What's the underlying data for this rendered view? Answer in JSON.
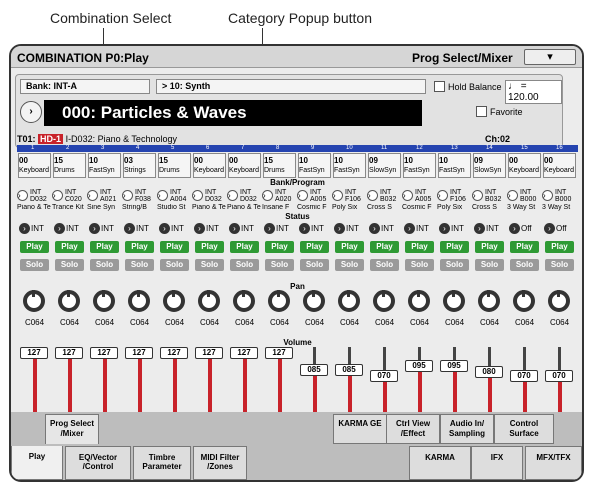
{
  "callouts": {
    "combo_select": "Combination Select",
    "category_popup": "Category Popup button"
  },
  "header": {
    "title": "COMBINATION P0:Play",
    "page_menu": "Prog Select/Mixer",
    "menu_arrow": "▾"
  },
  "bank": {
    "label": "Bank: INT-A",
    "category": "10: Synth",
    "hold_balance": "Hold Balance",
    "tempo": "♩ = 120.00"
  },
  "combination": {
    "name": "000: Particles & Waves",
    "favorite": "Favorite"
  },
  "timbre_info": {
    "timbre": "T01:",
    "hd": "HD-1",
    "program": "I-D032: Piano & Technology",
    "channel": "Ch:02"
  },
  "section_labels": {
    "bank_program": "Bank/Program",
    "status": "Status",
    "pan": "Pan",
    "volume": "Volume"
  },
  "timbres": [
    {
      "num": "1",
      "cat_num": "00",
      "cat": "Keyboard",
      "bank": "INT",
      "prog": "D032",
      "name": "Piano & Te",
      "status": "INT",
      "play": "Play",
      "solo": "Solo",
      "pan": "C064",
      "vol": "127",
      "level": 1.0
    },
    {
      "num": "2",
      "cat_num": "15",
      "cat": "Drums",
      "bank": "INT",
      "prog": "C020",
      "name": "Trance Kit",
      "status": "INT",
      "play": "Play",
      "solo": "Solo",
      "pan": "C064",
      "vol": "127",
      "level": 1.0
    },
    {
      "num": "3",
      "cat_num": "10",
      "cat": "FastSyn",
      "bank": "INT",
      "prog": "A021",
      "name": "Sine Syn",
      "status": "INT",
      "play": "Play",
      "solo": "Solo",
      "pan": "C064",
      "vol": "127",
      "level": 1.0
    },
    {
      "num": "4",
      "cat_num": "03",
      "cat": "Strings",
      "bank": "INT",
      "prog": "F038",
      "name": "String/B",
      "status": "INT",
      "play": "Play",
      "solo": "Solo",
      "pan": "C064",
      "vol": "127",
      "level": 1.0
    },
    {
      "num": "5",
      "cat_num": "15",
      "cat": "Drums",
      "bank": "INT",
      "prog": "A004",
      "name": "Studio St",
      "status": "INT",
      "play": "Play",
      "solo": "Solo",
      "pan": "C064",
      "vol": "127",
      "level": 1.0
    },
    {
      "num": "6",
      "cat_num": "00",
      "cat": "Keyboard",
      "bank": "INT",
      "prog": "D032",
      "name": "Piano & Te",
      "status": "INT",
      "play": "Play",
      "solo": "Solo",
      "pan": "C064",
      "vol": "127",
      "level": 1.0
    },
    {
      "num": "7",
      "cat_num": "00",
      "cat": "Keyboard",
      "bank": "INT",
      "prog": "D032",
      "name": "Piano & Te",
      "status": "INT",
      "play": "Play",
      "solo": "Solo",
      "pan": "C064",
      "vol": "127",
      "level": 1.0
    },
    {
      "num": "8",
      "cat_num": "15",
      "cat": "Drums",
      "bank": "INT",
      "prog": "A020",
      "name": "Insane F",
      "status": "INT",
      "play": "Play",
      "solo": "Solo",
      "pan": "C064",
      "vol": "127",
      "level": 1.0
    },
    {
      "num": "9",
      "cat_num": "10",
      "cat": "FastSyn",
      "bank": "INT",
      "prog": "A005",
      "name": "Cosmic F",
      "status": "INT",
      "play": "Play",
      "solo": "Solo",
      "pan": "C064",
      "vol": "085",
      "level": 0.67
    },
    {
      "num": "10",
      "cat_num": "10",
      "cat": "FastSyn",
      "bank": "INT",
      "prog": "F106",
      "name": "Poly Six",
      "status": "INT",
      "play": "Play",
      "solo": "Solo",
      "pan": "C064",
      "vol": "085",
      "level": 0.67
    },
    {
      "num": "11",
      "cat_num": "09",
      "cat": "SlowSyn",
      "bank": "INT",
      "prog": "B032",
      "name": "Cross S",
      "status": "INT",
      "play": "Play",
      "solo": "Solo",
      "pan": "C064",
      "vol": "070",
      "level": 0.55
    },
    {
      "num": "12",
      "cat_num": "10",
      "cat": "FastSyn",
      "bank": "INT",
      "prog": "A005",
      "name": "Cosmic F",
      "status": "INT",
      "play": "Play",
      "solo": "Solo",
      "pan": "C064",
      "vol": "095",
      "level": 0.75
    },
    {
      "num": "13",
      "cat_num": "10",
      "cat": "FastSyn",
      "bank": "INT",
      "prog": "F106",
      "name": "Poly Six",
      "status": "INT",
      "play": "Play",
      "solo": "Solo",
      "pan": "C064",
      "vol": "095",
      "level": 0.75
    },
    {
      "num": "14",
      "cat_num": "09",
      "cat": "SlowSyn",
      "bank": "INT",
      "prog": "B032",
      "name": "Cross S",
      "status": "INT",
      "play": "Play",
      "solo": "Solo",
      "pan": "C064",
      "vol": "080",
      "level": 0.63
    },
    {
      "num": "15",
      "cat_num": "00",
      "cat": "Keyboard",
      "bank": "INT",
      "prog": "B000",
      "name": "3 Way St",
      "status": "Off",
      "play": "Play",
      "solo": "Solo",
      "pan": "C064",
      "vol": "070",
      "level": 0.55
    },
    {
      "num": "16",
      "cat_num": "00",
      "cat": "Keyboard",
      "bank": "INT",
      "prog": "B000",
      "name": "3 Way St",
      "status": "Off",
      "play": "Play",
      "solo": "Solo",
      "pan": "C064",
      "vol": "070",
      "level": 0.55
    }
  ],
  "upper_tabs": [
    {
      "label": "Prog Select\n/Mixer"
    },
    {
      "label": "KARMA GE"
    },
    {
      "label": "Ctrl View\n/Effect"
    },
    {
      "label": "Audio In/\nSampling"
    },
    {
      "label": "Control\nSurface"
    }
  ],
  "lower_tabs": [
    {
      "label": "Play"
    },
    {
      "label": "EQ/Vector\n/Control"
    },
    {
      "label": "Timbre\nParameter"
    },
    {
      "label": "MIDI Filter\n/Zones"
    },
    {
      "label": "KARMA"
    },
    {
      "label": "IFX"
    },
    {
      "label": "MFX/TFX"
    }
  ],
  "colors": {
    "accent": "#2544b0",
    "play": "#2e9a34",
    "volume": "#c8222a",
    "hd": "#c8222a"
  }
}
